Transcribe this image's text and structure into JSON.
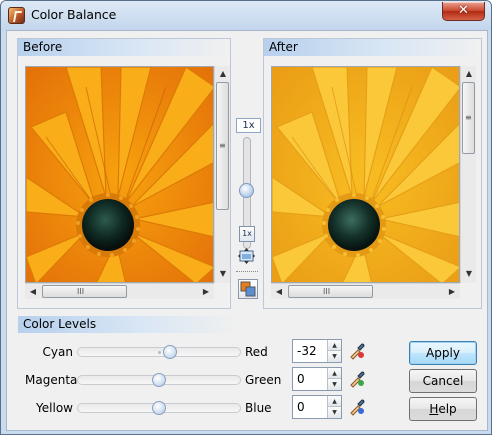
{
  "window": {
    "title": "Color Balance",
    "close_glyph": "✕"
  },
  "before": {
    "header": "Before"
  },
  "after": {
    "header": "After"
  },
  "zoom": {
    "value_label": "1x",
    "reset_label": "1x"
  },
  "scroll": {
    "up": "▲",
    "down": "▼",
    "left": "◀",
    "right": "▶",
    "grip_v": "≡",
    "grip_h": "III"
  },
  "color_levels": {
    "header": "Color Levels",
    "rows": [
      {
        "left": "Cyan",
        "right": "Red",
        "value": "-32",
        "level": -32
      },
      {
        "left": "Magenta",
        "right": "Green",
        "value": "0",
        "level": 0
      },
      {
        "left": "Yellow",
        "right": "Blue",
        "value": "0",
        "level": 0
      }
    ],
    "spin_up": "▲",
    "spin_down": "▼"
  },
  "buttons": {
    "apply": "Apply",
    "cancel": "Cancel",
    "help_first": "H",
    "help_rest": "elp"
  },
  "colors": {
    "title_bg": "#c3d6ec",
    "panel_head": "#b7d0ed",
    "default_btn": "#a7d9f5",
    "close_red": "#cc4a32"
  }
}
